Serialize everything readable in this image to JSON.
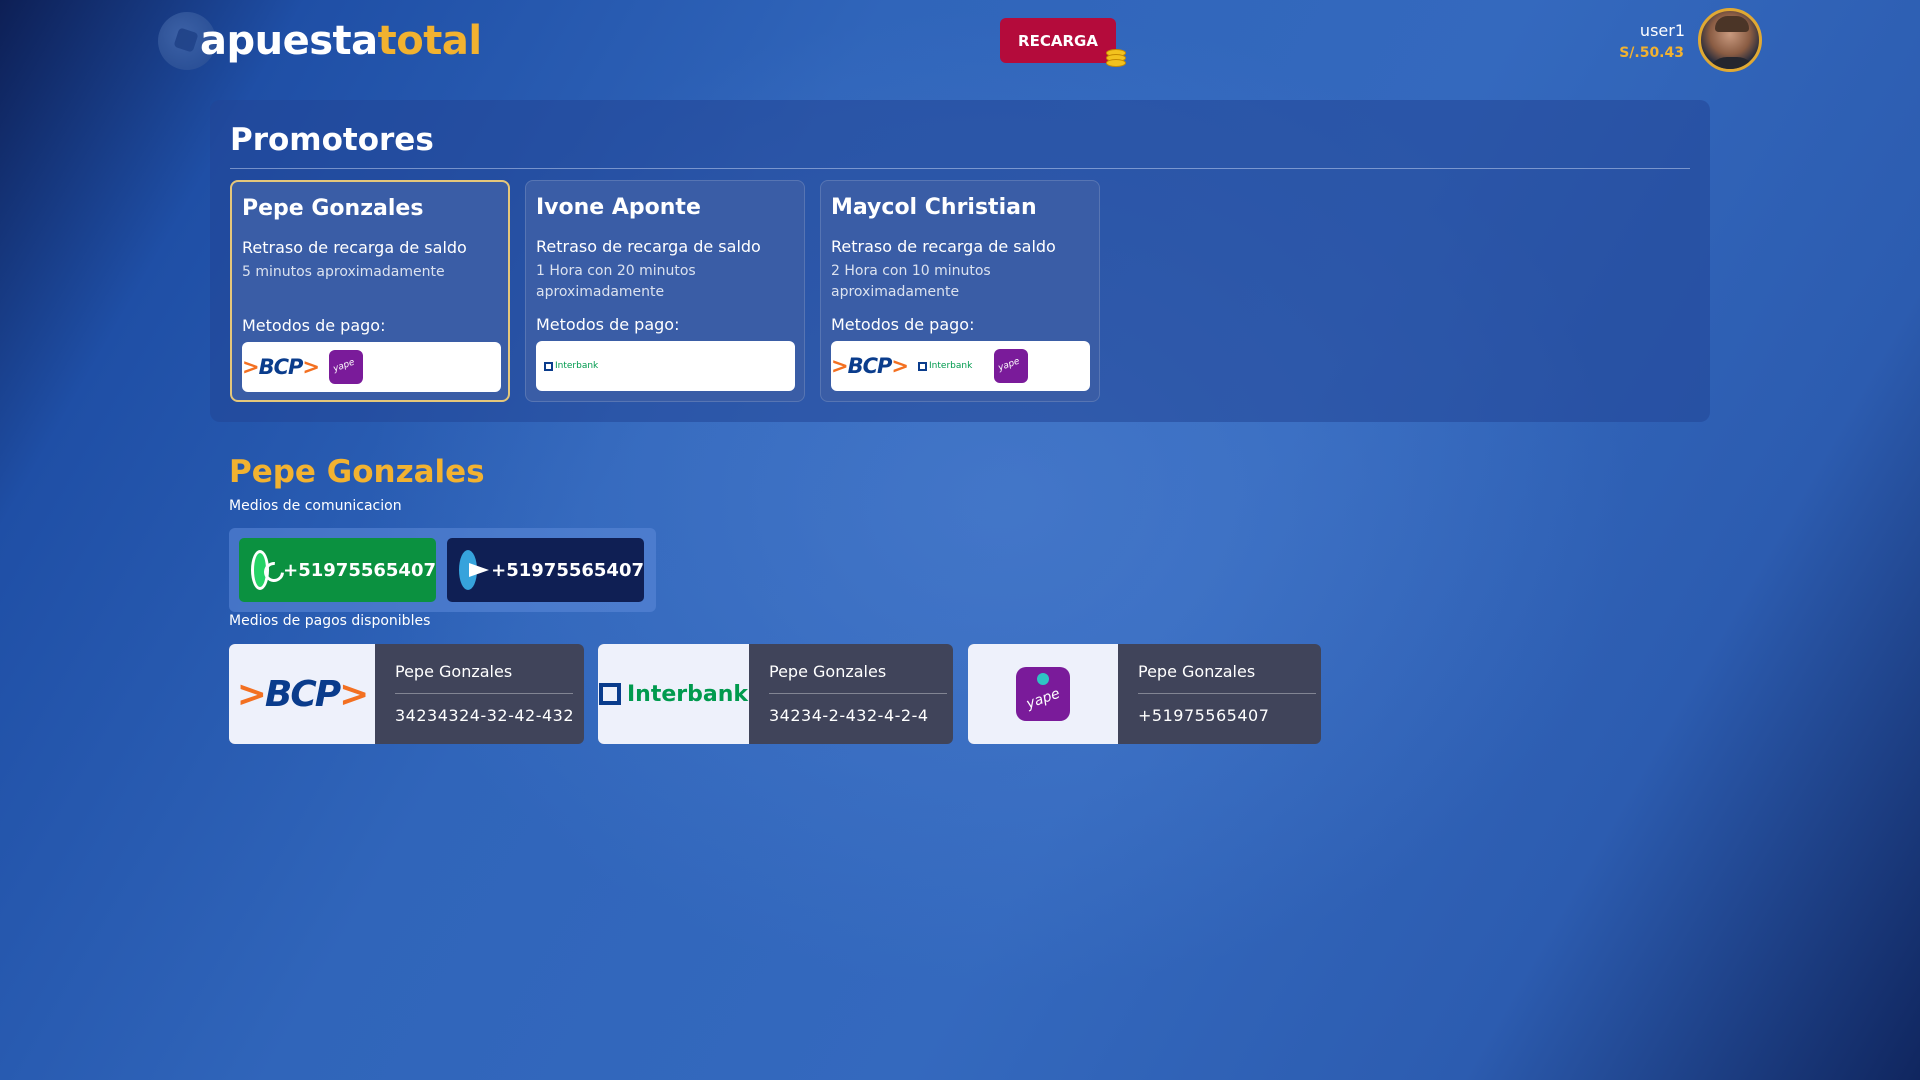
{
  "header": {
    "brand_part1": "apuesta",
    "brand_part2": "total",
    "recarga_label": "RECARGA",
    "username": "user1",
    "balance": "S/.50.43"
  },
  "promotores": {
    "title": "Promotores",
    "cards": [
      {
        "name": "Pepe Gonzales",
        "delay_label": "Retraso de recarga de saldo",
        "estimate": "5 minutos aproximadamente",
        "methods_label": "Metodos de pago:",
        "methods": [
          "bcp",
          "yape"
        ],
        "selected": true
      },
      {
        "name": "Ivone Aponte",
        "delay_label": "Retraso de recarga de saldo",
        "estimate": "1 Hora con 20 minutos aproximadamente",
        "methods_label": "Metodos de pago:",
        "methods": [
          "interbank"
        ],
        "selected": false
      },
      {
        "name": "Maycol Christian",
        "delay_label": "Retraso de recarga de saldo",
        "estimate": "2 Hora con 10 minutos aproximadamente",
        "methods_label": "Metodos de pago:",
        "methods": [
          "bcp",
          "interbank",
          "yape"
        ],
        "selected": false
      }
    ]
  },
  "selected": {
    "name": "Pepe Gonzales",
    "comm_label": "Medios de comunicacion",
    "whatsapp": "+51975565407",
    "telegram": "+51975565407",
    "pay_label": "Medios de pagos disponibles",
    "payments": [
      {
        "bank": "bcp",
        "logo_text": "BCP",
        "holder": "Pepe Gonzales",
        "account": "34234324-32-42-432"
      },
      {
        "bank": "interbank",
        "logo_text": "Interbank",
        "holder": "Pepe Gonzales",
        "account": "34234-2-432-4-2-4"
      },
      {
        "bank": "yape",
        "logo_text": "yape",
        "holder": "Pepe Gonzales",
        "account": "+51975565407"
      }
    ]
  },
  "icons": {
    "whatsapp": "whatsapp-icon",
    "telegram": "telegram-icon",
    "coins": "coins-icon",
    "ball": "soccer-ball-icon"
  },
  "colors": {
    "accent_gold": "#f2b230",
    "recarga_red": "#b40b3b",
    "whatsapp_green": "#0b9140",
    "telegram_navy": "#0f1f54"
  }
}
